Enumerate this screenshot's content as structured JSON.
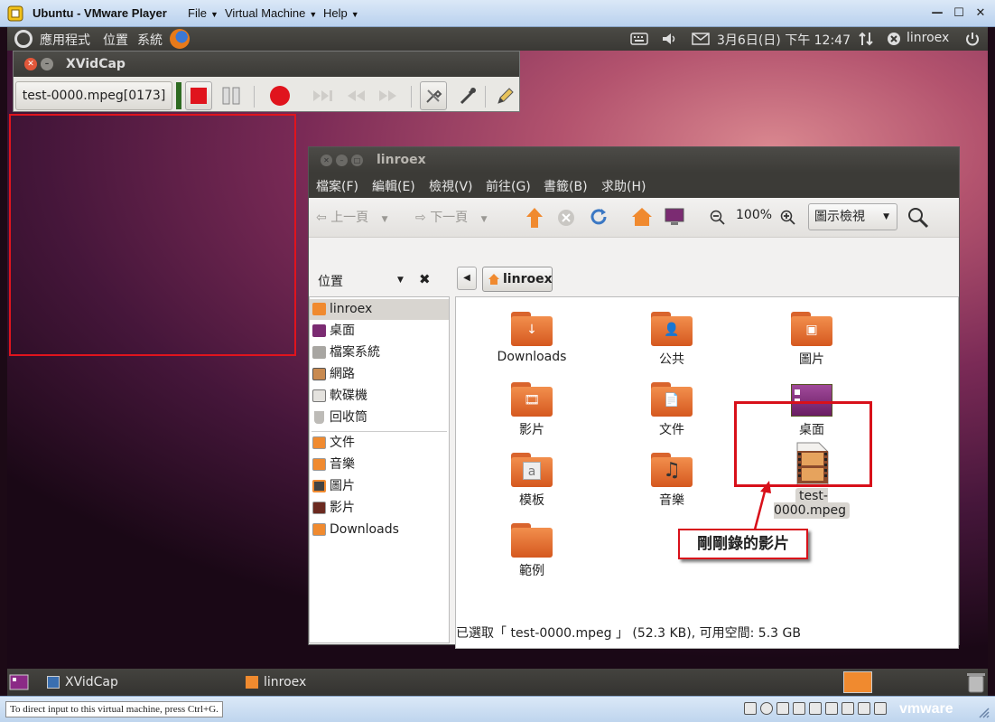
{
  "host_window": {
    "title": "Ubuntu - VMware Player",
    "menus": [
      "File",
      "Virtual Machine",
      "Help"
    ],
    "status_message": "To direct input to this virtual machine, press Ctrl+G.",
    "vmware_logo": "vmware"
  },
  "top_panel": {
    "menus": [
      "應用程式",
      "位置",
      "系統"
    ],
    "clock": "3月6日(日) 下午 12:47",
    "user": "linroex"
  },
  "xvidcap": {
    "title": "XVidCap",
    "file_label": "test-0000.mpeg[0173]",
    "record_color": "#e0141d"
  },
  "nautilus": {
    "title": "linroex",
    "menus": [
      "檔案(F)",
      "編輯(E)",
      "檢視(V)",
      "前往(G)",
      "書籤(B)",
      "求助(H)"
    ],
    "toolbar": {
      "back": "上一頁",
      "forward": "下一頁",
      "zoom": "100%",
      "view_mode": "圖示檢視"
    },
    "sidebar_title": "位置",
    "path_button": "linroex",
    "places": [
      {
        "label": "linroex",
        "icon": "home-icon",
        "selected": true
      },
      {
        "label": "桌面",
        "icon": "desktop-icon"
      },
      {
        "label": "檔案系統",
        "icon": "drive-icon"
      },
      {
        "label": "網路",
        "icon": "network-icon"
      },
      {
        "label": "軟碟機",
        "icon": "floppy-icon"
      },
      {
        "label": "回收筒",
        "icon": "trash-icon"
      }
    ],
    "bookmarks": [
      {
        "label": "文件",
        "icon": "documents-icon"
      },
      {
        "label": "音樂",
        "icon": "music-icon"
      },
      {
        "label": "圖片",
        "icon": "pictures-icon"
      },
      {
        "label": "影片",
        "icon": "videos-icon"
      },
      {
        "label": "Downloads",
        "icon": "downloads-icon"
      }
    ],
    "items": [
      {
        "label": "Downloads",
        "emblem": "↓"
      },
      {
        "label": "公共",
        "emblem": "👤"
      },
      {
        "label": "圖片",
        "emblem": "▣"
      },
      {
        "label": "影片",
        "emblem": "🎞"
      },
      {
        "label": "文件",
        "emblem": "📄"
      },
      {
        "label": "桌面",
        "emblem": ""
      },
      {
        "label": "模板",
        "emblem": "a"
      },
      {
        "label": "音樂",
        "emblem": "♫"
      },
      {
        "label": "test-0000.mpeg",
        "emblem": ""
      },
      {
        "label": "範例",
        "emblem": ""
      }
    ],
    "status": "已選取「 test-0000.mpeg 」 (52.3 KB), 可用空間: 5.3 GB"
  },
  "annotation": {
    "callout_text": "剛剛錄的影片",
    "color": "#d8101a"
  },
  "bottom_panel": {
    "tasks": [
      "XVidCap",
      "linroex"
    ]
  }
}
